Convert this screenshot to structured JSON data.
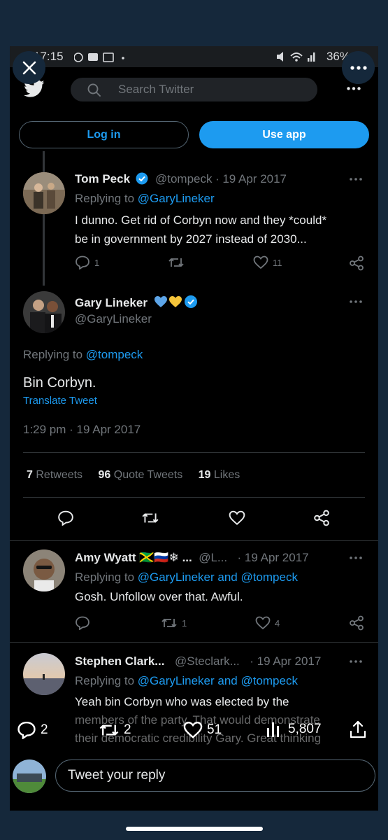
{
  "status_bar": {
    "time": "17:15",
    "battery": "36%"
  },
  "header": {
    "search_placeholder": "Search Twitter"
  },
  "auth": {
    "login_label": "Log in",
    "use_app_label": "Use app"
  },
  "parent_tweet": {
    "author": "Tom Peck",
    "handle": "@tompeck",
    "date": "· 19 Apr 2017",
    "replying_prefix": "Replying to",
    "replying_to": "@GaryLineker",
    "text_line1": "I dunno. Get rid of Corbyn now and they *could*",
    "text_line2": "be in government by 2027 instead of 2030...",
    "reply_count": "1",
    "like_count": "11"
  },
  "main_tweet": {
    "author": "Gary Lineker",
    "handle": "@GaryLineker",
    "replying_prefix": "Replying to",
    "replying_to": "@tompeck",
    "text": "Bin Corbyn.",
    "translate_label": "Translate Tweet",
    "timestamp": "1:29 pm · 19 Apr 2017",
    "retweets_count": "7",
    "retweets_label": "Retweets",
    "quotes_count": "96",
    "quotes_label": "Quote Tweets",
    "likes_count": "19",
    "likes_label": "Likes"
  },
  "replies": [
    {
      "author": "Amy Wyatt 🇯🇲🇷🇺❄ ...",
      "handle": "@L...",
      "date": "· 19 Apr 2017",
      "replying_prefix": "Replying to",
      "replying_to": "@GaryLineker and @tompeck",
      "text_line1": "Gosh. Unfollow over that. Awful.",
      "retweet_count": "1",
      "like_count": "4"
    },
    {
      "author": "Stephen Clark...",
      "handle": "@Steclark...",
      "date": "· 19 Apr 2017",
      "replying_prefix": "Replying to",
      "replying_to": "@GaryLineker and @tompeck",
      "text_line1": "Yeah bin Corbyn who was elected by the",
      "text_line2": "members of the party. That would demonstrate",
      "text_line3": "their democratic credibility Gary. Great thinking"
    }
  ],
  "bottom_stats": {
    "replies": "2",
    "retweets": "2",
    "likes": "51",
    "views": "5,807"
  },
  "reply_bar": {
    "placeholder": "Tweet your reply"
  },
  "colors": {
    "accent": "#1d9bf0",
    "background": "#000000",
    "muted": "#71767b",
    "frame": "#15283b"
  }
}
